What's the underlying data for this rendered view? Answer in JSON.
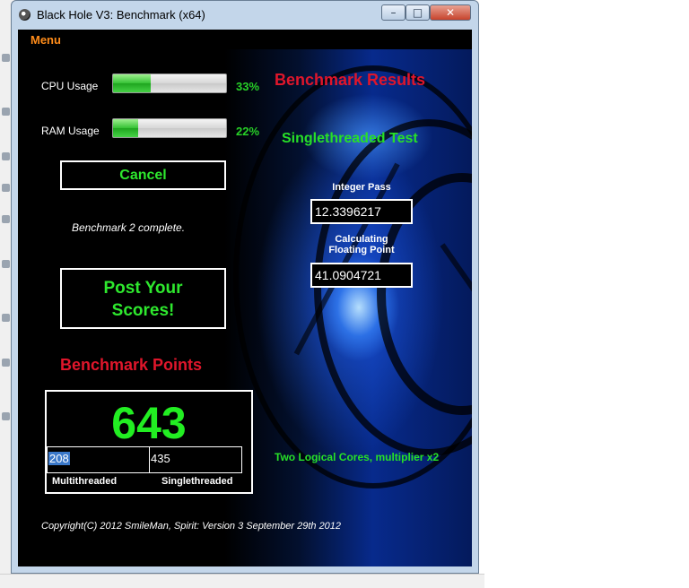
{
  "window": {
    "title": "Black Hole V3: Benchmark (x64)",
    "minimize_glyph": "–",
    "maximize_glyph": "□",
    "close_glyph": "✕"
  },
  "menu": {
    "label": "Menu"
  },
  "usage": {
    "cpu": {
      "label": "CPU Usage",
      "percent_text": "33%",
      "level": 0.33
    },
    "ram": {
      "label": "RAM Usage",
      "percent_text": "22%",
      "level": 0.22
    }
  },
  "buttons": {
    "cancel": "Cancel",
    "post_line1": "Post Your",
    "post_line2": "Scores!"
  },
  "status_text": "Benchmark 2 complete.",
  "results": {
    "title": "Benchmark Results",
    "test_title": "Singlethreaded Test",
    "integer_label": "Integer Pass",
    "integer_value": "12.3396217",
    "float_label_line1": "Calculating",
    "float_label_line2": "Floating Point",
    "float_value": "41.0904721"
  },
  "points": {
    "title": "Benchmark Points",
    "total": "643",
    "multithreaded_value": "208",
    "singlethreaded_value": "435",
    "multithreaded_label": "Multithreaded",
    "singlethreaded_label": "Singlethreaded"
  },
  "cores_text": "Two Logical Cores, multiplier x2",
  "copyright": "Copyright(C) 2012 SmileMan, Spirit: Version 3 September 29th 2012",
  "colors": {
    "accent_green": "#27e027",
    "accent_red": "#e0162b",
    "menu_orange": "#ff8c1a"
  }
}
